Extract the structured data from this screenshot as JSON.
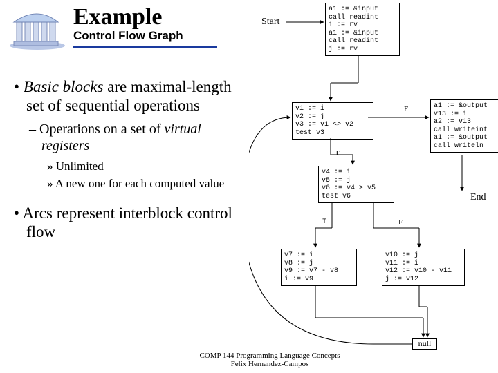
{
  "header": {
    "title": "Example",
    "subtitle": "Control Flow Graph"
  },
  "bullets": {
    "b1a_pre": "• ",
    "b1a_em": "Basic blocks",
    "b1a_post": " are maximal-length set of sequential operations",
    "b2a_pre": "– Operations on a set of ",
    "b2a_em": "virtual registers",
    "b3a": "» Unlimited",
    "b3b": "» A new one for each computed value",
    "b1b": "• Arcs represent interblock control flow"
  },
  "flow": {
    "start": "Start",
    "end": "End",
    "null": "null",
    "T": "T",
    "F1": "F",
    "F2": "F",
    "box1": "a1 := &input\ncall readint\ni := rv\na1 := &input\ncall readint\nj := rv",
    "box2": "v1 := i\nv2 := j\nv3 := v1 <> v2\ntest v3",
    "box3": "a1 := &output\nv13 := i\na2 := v13\ncall writeint\na1 := &output\ncall writeln",
    "box4": "v4 := i\nv5 := j\nv6 := v4 > v5\ntest v6",
    "box5": "v7 := i\nv8 := j\nv9 := v7 - v8\ni := v9",
    "box6": "v10 := j\nv11 := i\nv12 := v10 - v11\nj := v12"
  },
  "footer": {
    "line1": "COMP 144 Programming Language Concepts",
    "line2": "Felix Hernandez-Campos"
  }
}
